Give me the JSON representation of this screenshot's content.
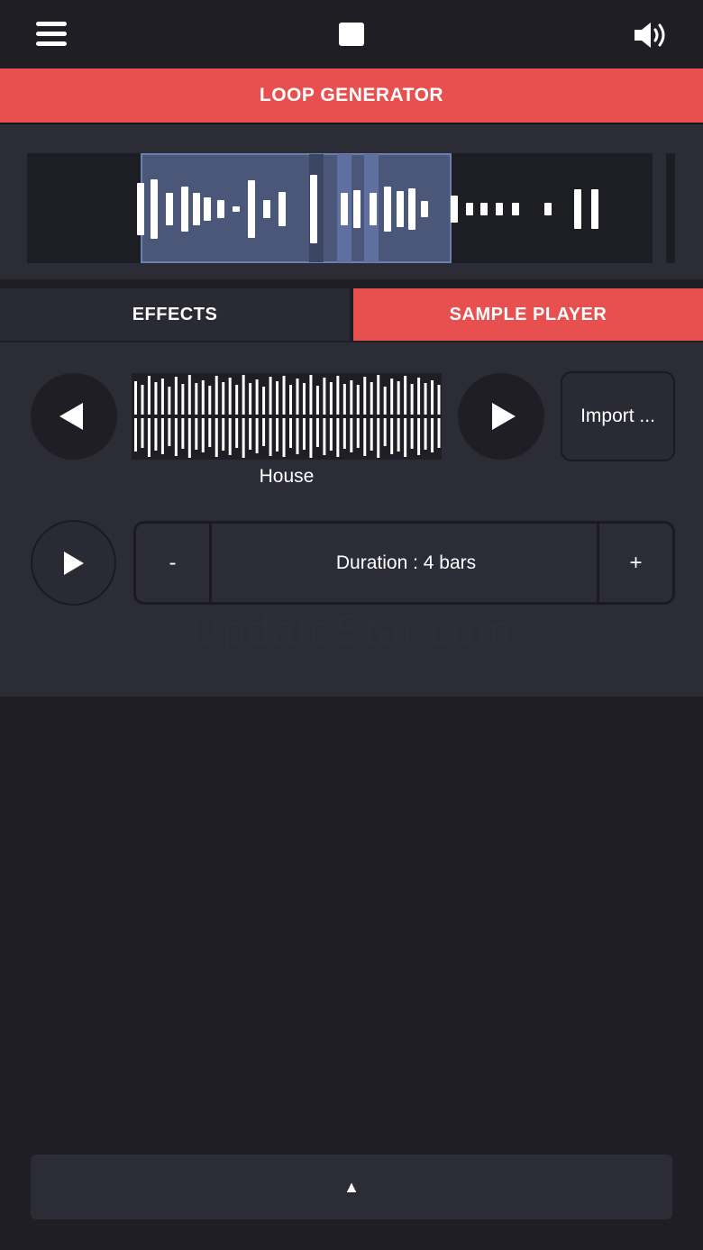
{
  "topbar": {
    "menu_icon": "hamburger-menu-icon",
    "stop_icon": "stop-square-icon",
    "volume_icon": "speaker-volume-icon"
  },
  "header": {
    "title": "LOOP GENERATOR"
  },
  "tabs": [
    {
      "label": "EFFECTS",
      "active": false
    },
    {
      "label": "SAMPLE PLAYER",
      "active": true
    }
  ],
  "sample_player": {
    "prev_icon": "triangle-left-icon",
    "next_icon": "triangle-right-icon",
    "sample_name": "House",
    "import_label": "Import ...",
    "play_icon": "play-triangle-icon",
    "duration_minus": "-",
    "duration_label": "Duration : 4 bars",
    "duration_plus": "+"
  },
  "watermark": "UpdateStar.com",
  "bottom": {
    "expand_glyph": "▲"
  },
  "colors": {
    "accent": "#e84f4f",
    "background": "#1e1e24",
    "panel": "#2c2c37",
    "selection": "#56658f"
  }
}
